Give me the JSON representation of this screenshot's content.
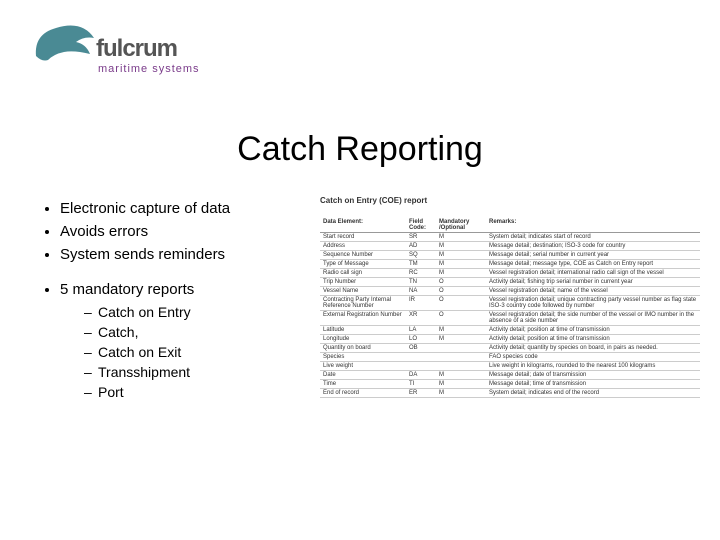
{
  "logo": {
    "brand": "fulcrum",
    "tagline": "maritime systems",
    "accent": "#4a8a94",
    "tagline_color": "#7a3b8a"
  },
  "title": "Catch Reporting",
  "bullets": {
    "items": [
      "Electronic capture of data",
      "Avoids errors",
      "System sends reminders"
    ],
    "section": "5 mandatory reports",
    "sub": [
      "Catch on Entry",
      "Catch,",
      "Catch on Exit",
      "Transshipment",
      "Port"
    ]
  },
  "table": {
    "title": "Catch on Entry (COE) report",
    "head": {
      "c1": "Data Element:",
      "c2": "Field Code:",
      "c3": "Mandatory /Optional",
      "c4": "Remarks:"
    },
    "rows": [
      {
        "c1": "Start record",
        "c2": "SR",
        "c3": "M",
        "c4": "System detail; indicates start of record"
      },
      {
        "c1": "Address",
        "c2": "AD",
        "c3": "M",
        "c4": "Message detail; destination; ISO-3 code for country"
      },
      {
        "c1": "Sequence Number",
        "c2": "SQ",
        "c3": "M",
        "c4": "Message detail; serial number in current year"
      },
      {
        "c1": "Type of Message",
        "c2": "TM",
        "c3": "M",
        "c4": "Message detail; message type, COE as Catch on Entry report"
      },
      {
        "c1": "Radio call sign",
        "c2": "RC",
        "c3": "M",
        "c4": "Vessel registration detail; international radio call sign of the vessel"
      },
      {
        "c1": "Trip Number",
        "c2": "TN",
        "c3": "O",
        "c4": "Activity detail; fishing trip serial number in current year"
      },
      {
        "c1": "Vessel Name",
        "c2": "NA",
        "c3": "O",
        "c4": "Vessel registration detail; name of the vessel"
      },
      {
        "c1": "Contracting Party Internal Reference Number",
        "c2": "IR",
        "c3": "O",
        "c4": "Vessel registration detail; unique contracting party vessel number as flag state ISO-3 country code followed by number"
      },
      {
        "c1": "External Registration Number",
        "c2": "XR",
        "c3": "O",
        "c4": "Vessel registration detail; the side number of the vessel or IMO number in the absence of a side number"
      },
      {
        "c1": "Latitude",
        "c2": "LA",
        "c3": "M",
        "c4": "Activity detail; position at time of transmission"
      },
      {
        "c1": "Longitude",
        "c2": "LO",
        "c3": "M",
        "c4": "Activity detail; position at time of transmission"
      },
      {
        "c1": "Quantity on board",
        "c2": "OB",
        "c3": "",
        "c4": "Activity detail; quantity by species on board, in pairs as needed."
      },
      {
        "c1": "Species",
        "c2": "",
        "c3": "",
        "c4": "FAO species code",
        "indent": true
      },
      {
        "c1": "Live weight",
        "c2": "",
        "c3": "",
        "c4": "Live weight in kilograms, rounded to the nearest 100 kilograms",
        "indent": true
      },
      {
        "c1": "Date",
        "c2": "DA",
        "c3": "M",
        "c4": "Message detail; date of transmission"
      },
      {
        "c1": "Time",
        "c2": "TI",
        "c3": "M",
        "c4": "Message detail; time of transmission"
      },
      {
        "c1": "End of record",
        "c2": "ER",
        "c3": "M",
        "c4": "System detail; indicates end of the record"
      }
    ]
  }
}
